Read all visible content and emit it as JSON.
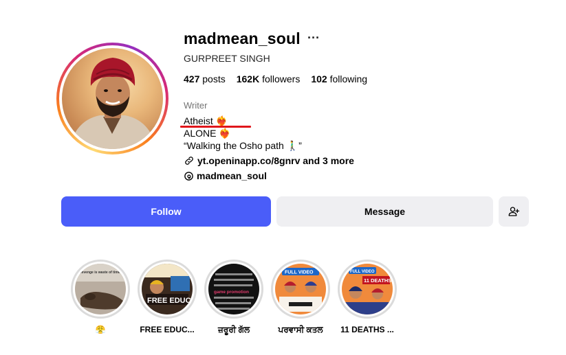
{
  "profile": {
    "username": "madmean_soul",
    "more_icon": "ellipsis-icon",
    "full_name": "GURPREET SINGH",
    "stats": {
      "posts_count": "427",
      "posts_label": "posts",
      "followers_count": "162K",
      "followers_label": "followers",
      "following_count": "102",
      "following_label": "following"
    },
    "category": "Writer",
    "bio": {
      "line1": "Atheist",
      "line1_emoji": "❤️‍🔥",
      "line2": "ALONE",
      "line2_emoji": "❤️‍🔥",
      "line3": "“Walking the Osho path 🚶‍♂️”"
    },
    "link": "yt.openinapp.co/8gnrv and 3 more",
    "threads_handle": "madmean_soul"
  },
  "actions": {
    "follow_label": "Follow",
    "message_label": "Message",
    "add_user_icon": "add-person-icon"
  },
  "colors": {
    "follow_bg": "#4a5df9",
    "secondary_bg": "#efeff2",
    "annotation_red": "#e0161b"
  },
  "highlights": [
    {
      "label": "😤",
      "thumb_text": "Revenge is waste of time"
    },
    {
      "label": "FREE EDUC...",
      "thumb_text": "FREE EDUCATION"
    },
    {
      "label": "ਜ਼ਰੂਰੀ ਗੱਲ",
      "thumb_text": "game promotion"
    },
    {
      "label": "ਪਰਵਾਸੀ ਕਤਲ",
      "thumb_text": "FULL VIDEO"
    },
    {
      "label": "11 DEATHS ...",
      "thumb_text": "11 DEATHS"
    }
  ]
}
